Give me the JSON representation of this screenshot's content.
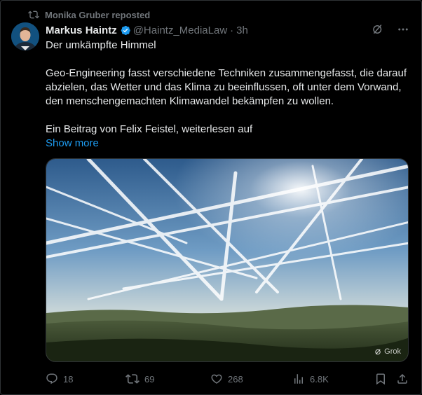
{
  "repost": {
    "text": "Monika Gruber reposted",
    "icon": "repost-icon"
  },
  "author": {
    "name": "Markus Haintz",
    "handle": "@Haintz_MediaLaw",
    "separator": "·",
    "time": "3h",
    "verified_color": "#1d9bf0"
  },
  "post": {
    "title": "Der umkämpfte Himmel",
    "body_lines": [
      "Geo-Engineering fasst verschiedene Techniken zusammengefasst, die darauf",
      "abzielen, das Wetter und das Klima zu beeinflussen, oft unter dem Vorwand,",
      "den menschengemachten Klimawandel bekämpfen zu wollen."
    ],
    "footer": "Ein Beitrag von Felix Feistel, weiterlesen auf",
    "show_more": "Show more"
  },
  "media": {
    "watermark": "Grok"
  },
  "actions": {
    "replies": "18",
    "reposts": "69",
    "likes": "268",
    "views": "6.8K"
  },
  "colors": {
    "background": "#000000",
    "text": "#e7e9ea",
    "muted": "#71767b",
    "link": "#1d9bf0"
  }
}
